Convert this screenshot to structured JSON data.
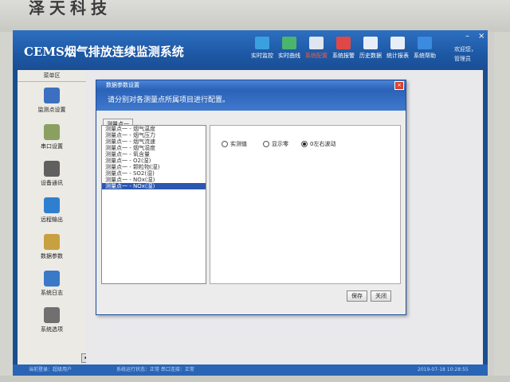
{
  "bezel": {
    "brand": "泽天科技"
  },
  "app": {
    "title": "CEMS烟气排放连续监测系统"
  },
  "toolbar": [
    {
      "label": "实时监控",
      "icon": "monitor-icon",
      "color": "#3aa0e0",
      "active": false
    },
    {
      "label": "实时曲线",
      "icon": "curve-icon",
      "color": "#4bb56e",
      "active": false
    },
    {
      "label": "系统配置",
      "icon": "config-icon",
      "color": "#dfe6f0",
      "active": true
    },
    {
      "label": "系统报警",
      "icon": "alarm-icon",
      "color": "#e04848",
      "active": false
    },
    {
      "label": "历史数据",
      "icon": "history-icon",
      "color": "#e8eef8",
      "active": false
    },
    {
      "label": "统计报表",
      "icon": "report-icon",
      "color": "#e8eef8",
      "active": false
    },
    {
      "label": "系统帮助",
      "icon": "help-icon",
      "color": "#3b8be0",
      "active": false
    }
  ],
  "user": {
    "welcome": "欢迎您，",
    "role": "管理员"
  },
  "sidebar": {
    "header": "菜单区",
    "items": [
      {
        "label": "监测点设置",
        "icon": "monitor-point-icon",
        "color": "#3c6fc0"
      },
      {
        "label": "串口设置",
        "icon": "serial-port-icon",
        "color": "#8aa060"
      },
      {
        "label": "设备通讯",
        "icon": "link-icon",
        "color": "#606060"
      },
      {
        "label": "远程输出",
        "icon": "globe-icon",
        "color": "#2f7fd0"
      },
      {
        "label": "数据参数",
        "icon": "edit-icon",
        "color": "#c8a040"
      },
      {
        "label": "系统日志",
        "icon": "clock-folder-icon",
        "color": "#3a78c8"
      },
      {
        "label": "系统选项",
        "icon": "tools-icon",
        "color": "#707070"
      }
    ]
  },
  "dialog": {
    "title": "数据参数设置",
    "header": "请分别对各测量点所属项目进行配置。",
    "tab": "测量点一",
    "tree": [
      "测量点一 - 烟气温度",
      "测量点一 - 烟气压力",
      "测量点一 - 烟气流速",
      "测量点一 - 烟气湿度",
      "测量点一 - 氧含量",
      "测量点一 - O2(湿)",
      "测量点一 - 颗粒物(湿)",
      "测量点一 - SO2(湿)",
      "测量点一 - NOx(湿)",
      "测量点一 - NOx(湿)"
    ],
    "selected_index": 9,
    "radios": [
      {
        "label": "实测值",
        "checked": false
      },
      {
        "label": "显示零",
        "checked": false
      },
      {
        "label": "0左右波动",
        "checked": true
      }
    ],
    "save_label": "保存",
    "close_label": "关闭"
  },
  "statusbar": {
    "left": "当前登录：超级用户",
    "mid": "系统运行状态：正常 串口连接：正常",
    "time": "2019-07-18 10:28:55"
  }
}
